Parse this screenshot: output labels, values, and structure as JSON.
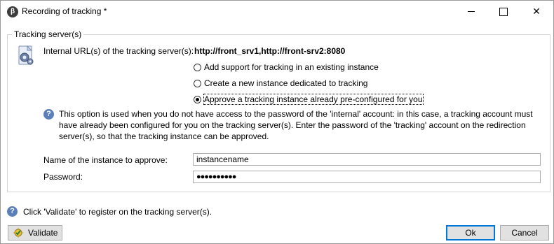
{
  "window": {
    "title": "Recording of tracking *",
    "app_icon_glyph": "β",
    "minimize_glyph": "—",
    "close_glyph": "✕"
  },
  "group": {
    "legend": "Tracking server(s)",
    "url_label": "Internal URL(s) of the tracking server(s):",
    "url_value": "http://front_srv1,http://front-srv2:8080",
    "icon": "server-gear-icon"
  },
  "options": [
    {
      "label": "Add support for tracking in an existing instance",
      "selected": false
    },
    {
      "label": "Create a new instance dedicated to tracking",
      "selected": false
    },
    {
      "label": "Approve a tracking instance already pre-configured for you",
      "selected": true
    }
  ],
  "info": {
    "icon": "help-icon",
    "glyph": "?",
    "text": "This option is used when you do not have access to the password of the 'internal' account: in this case, a tracking account must have already been configured for you on the tracking server(s). Enter the password of the 'tracking' account on the redirection server(s), so that the tracking instance can be approved."
  },
  "fields": {
    "instance_label": "Name of the instance to approve:",
    "instance_value": "instancename",
    "password_label": "Password:",
    "password_value": "●●●●●●●●●●"
  },
  "status": {
    "text": "Click 'Validate' to register on the tracking server(s).",
    "glyph": "?"
  },
  "buttons": {
    "validate": "Validate",
    "ok": "Ok",
    "cancel": "Cancel"
  },
  "colors": {
    "help_icon": "#5b7fb8",
    "default_button_border": "#0078d7"
  }
}
